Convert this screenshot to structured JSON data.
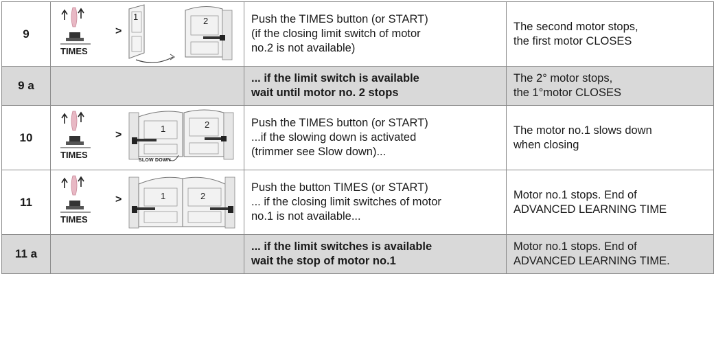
{
  "rows": [
    {
      "num": "9",
      "figure_button_label": "TIMES",
      "gate_numbers": [
        "1",
        "2"
      ],
      "action_lines": [
        "Push the TIMES button (or START)",
        "(if the closing limit switch of motor",
        "no.2 is not available)"
      ],
      "result_lines": [
        "The second motor stops,",
        "the first motor CLOSES"
      ]
    },
    {
      "num": "9 a",
      "action_lines": [
        "... if the limit switch is available",
        "wait until motor no. 2 stops"
      ],
      "result_lines": [
        "The 2° motor stops,",
        "the 1°motor CLOSES"
      ]
    },
    {
      "num": "10",
      "figure_button_label": "TIMES",
      "figure_note": "SLOW DOWN",
      "gate_numbers": [
        "1",
        "2"
      ],
      "action_lines": [
        "Push the TIMES button (or START)",
        "...if the slowing down is activated",
        "(trimmer see Slow down)..."
      ],
      "result_lines": [
        "The motor no.1 slows down",
        "when closing"
      ]
    },
    {
      "num": "11",
      "figure_button_label": "TIMES",
      "gate_numbers": [
        "1",
        "2"
      ],
      "action_lines": [
        "Push the button TIMES (or START)",
        "... if the closing limit switches of motor",
        "no.1 is not available..."
      ],
      "result_lines": [
        "Motor no.1 stops. End of",
        "ADVANCED LEARNING TIME"
      ]
    },
    {
      "num": "11 a",
      "action_lines": [
        "... if the limit switches is available",
        "wait the stop of motor no.1"
      ],
      "result_lines": [
        "Motor no.1 stops. End of",
        "ADVANCED LEARNING TIME."
      ]
    }
  ],
  "colors": {
    "shaded_row": "#d9d9d9",
    "border": "#8a8a8a",
    "remote_pink": "#e8b8c4"
  },
  "icons": [
    "remote-control-icon",
    "push-button-icon",
    "gate-diagram-icon",
    "motor-arm-icon"
  ]
}
